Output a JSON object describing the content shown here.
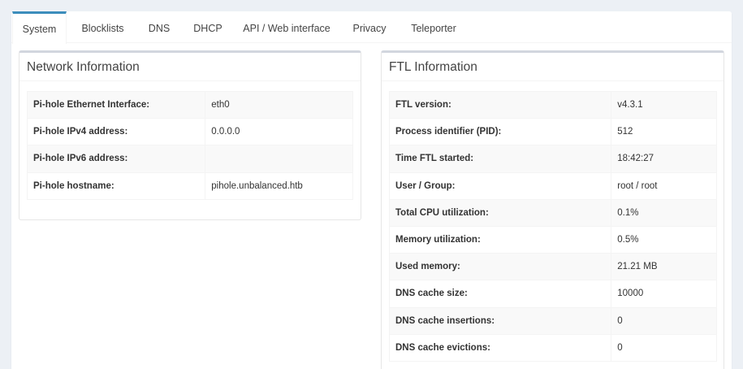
{
  "tabs": [
    {
      "label": "System",
      "active": true
    },
    {
      "label": "Blocklists"
    },
    {
      "label": "DNS"
    },
    {
      "label": "DHCP"
    },
    {
      "label": "API / Web interface"
    },
    {
      "label": "Privacy"
    },
    {
      "label": "Teleporter"
    }
  ],
  "network": {
    "title": "Network Information",
    "rows": [
      {
        "key": "Pi-hole Ethernet Interface:",
        "value": "eth0"
      },
      {
        "key": "Pi-hole IPv4 address:",
        "value": "0.0.0.0"
      },
      {
        "key": "Pi-hole IPv6 address:",
        "value": ""
      },
      {
        "key": "Pi-hole hostname:",
        "value": "pihole.unbalanced.htb"
      }
    ]
  },
  "ftl": {
    "title": "FTL Information",
    "rows": [
      {
        "key": "FTL version:",
        "value": "v4.3.1"
      },
      {
        "key": "Process identifier (PID):",
        "value": "512"
      },
      {
        "key": "Time FTL started:",
        "value": "18:42:27"
      },
      {
        "key": "User / Group:",
        "value": "root / root"
      },
      {
        "key": "Total CPU utilization:",
        "value": "0.1%"
      },
      {
        "key": "Memory utilization:",
        "value": "0.5%"
      },
      {
        "key": "Used memory:",
        "value": "21.21 MB"
      },
      {
        "key": "DNS cache size:",
        "value": "10000"
      },
      {
        "key": "DNS cache insertions:",
        "value": "0"
      },
      {
        "key": "DNS cache evictions:",
        "value": "0"
      }
    ]
  },
  "colors": {
    "accent": "#3c8dbc",
    "background": "#ecf0f5"
  }
}
